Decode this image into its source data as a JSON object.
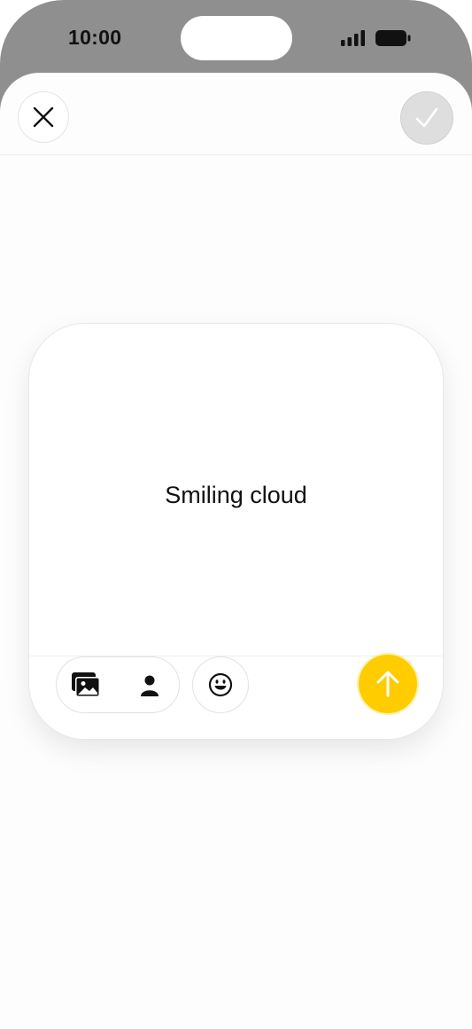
{
  "status_bar": {
    "time": "10:00",
    "signal_icon": "cellular-signal-icon",
    "battery_icon": "battery-full-icon"
  },
  "header": {
    "close_icon": "close-icon",
    "done_icon": "checkmark-icon"
  },
  "composer": {
    "text": "Smiling cloud",
    "toolbar": {
      "photos_icon": "photos-icon",
      "contact_icon": "person-icon",
      "emoji_icon": "emoji-icon",
      "send_icon": "arrow-up-icon"
    }
  },
  "colors": {
    "accent": "#ffcc00",
    "status_bar_bg": "#8f8f8f",
    "sheet_bg": "#fdfdfd",
    "done_disabled": "#dedede"
  }
}
